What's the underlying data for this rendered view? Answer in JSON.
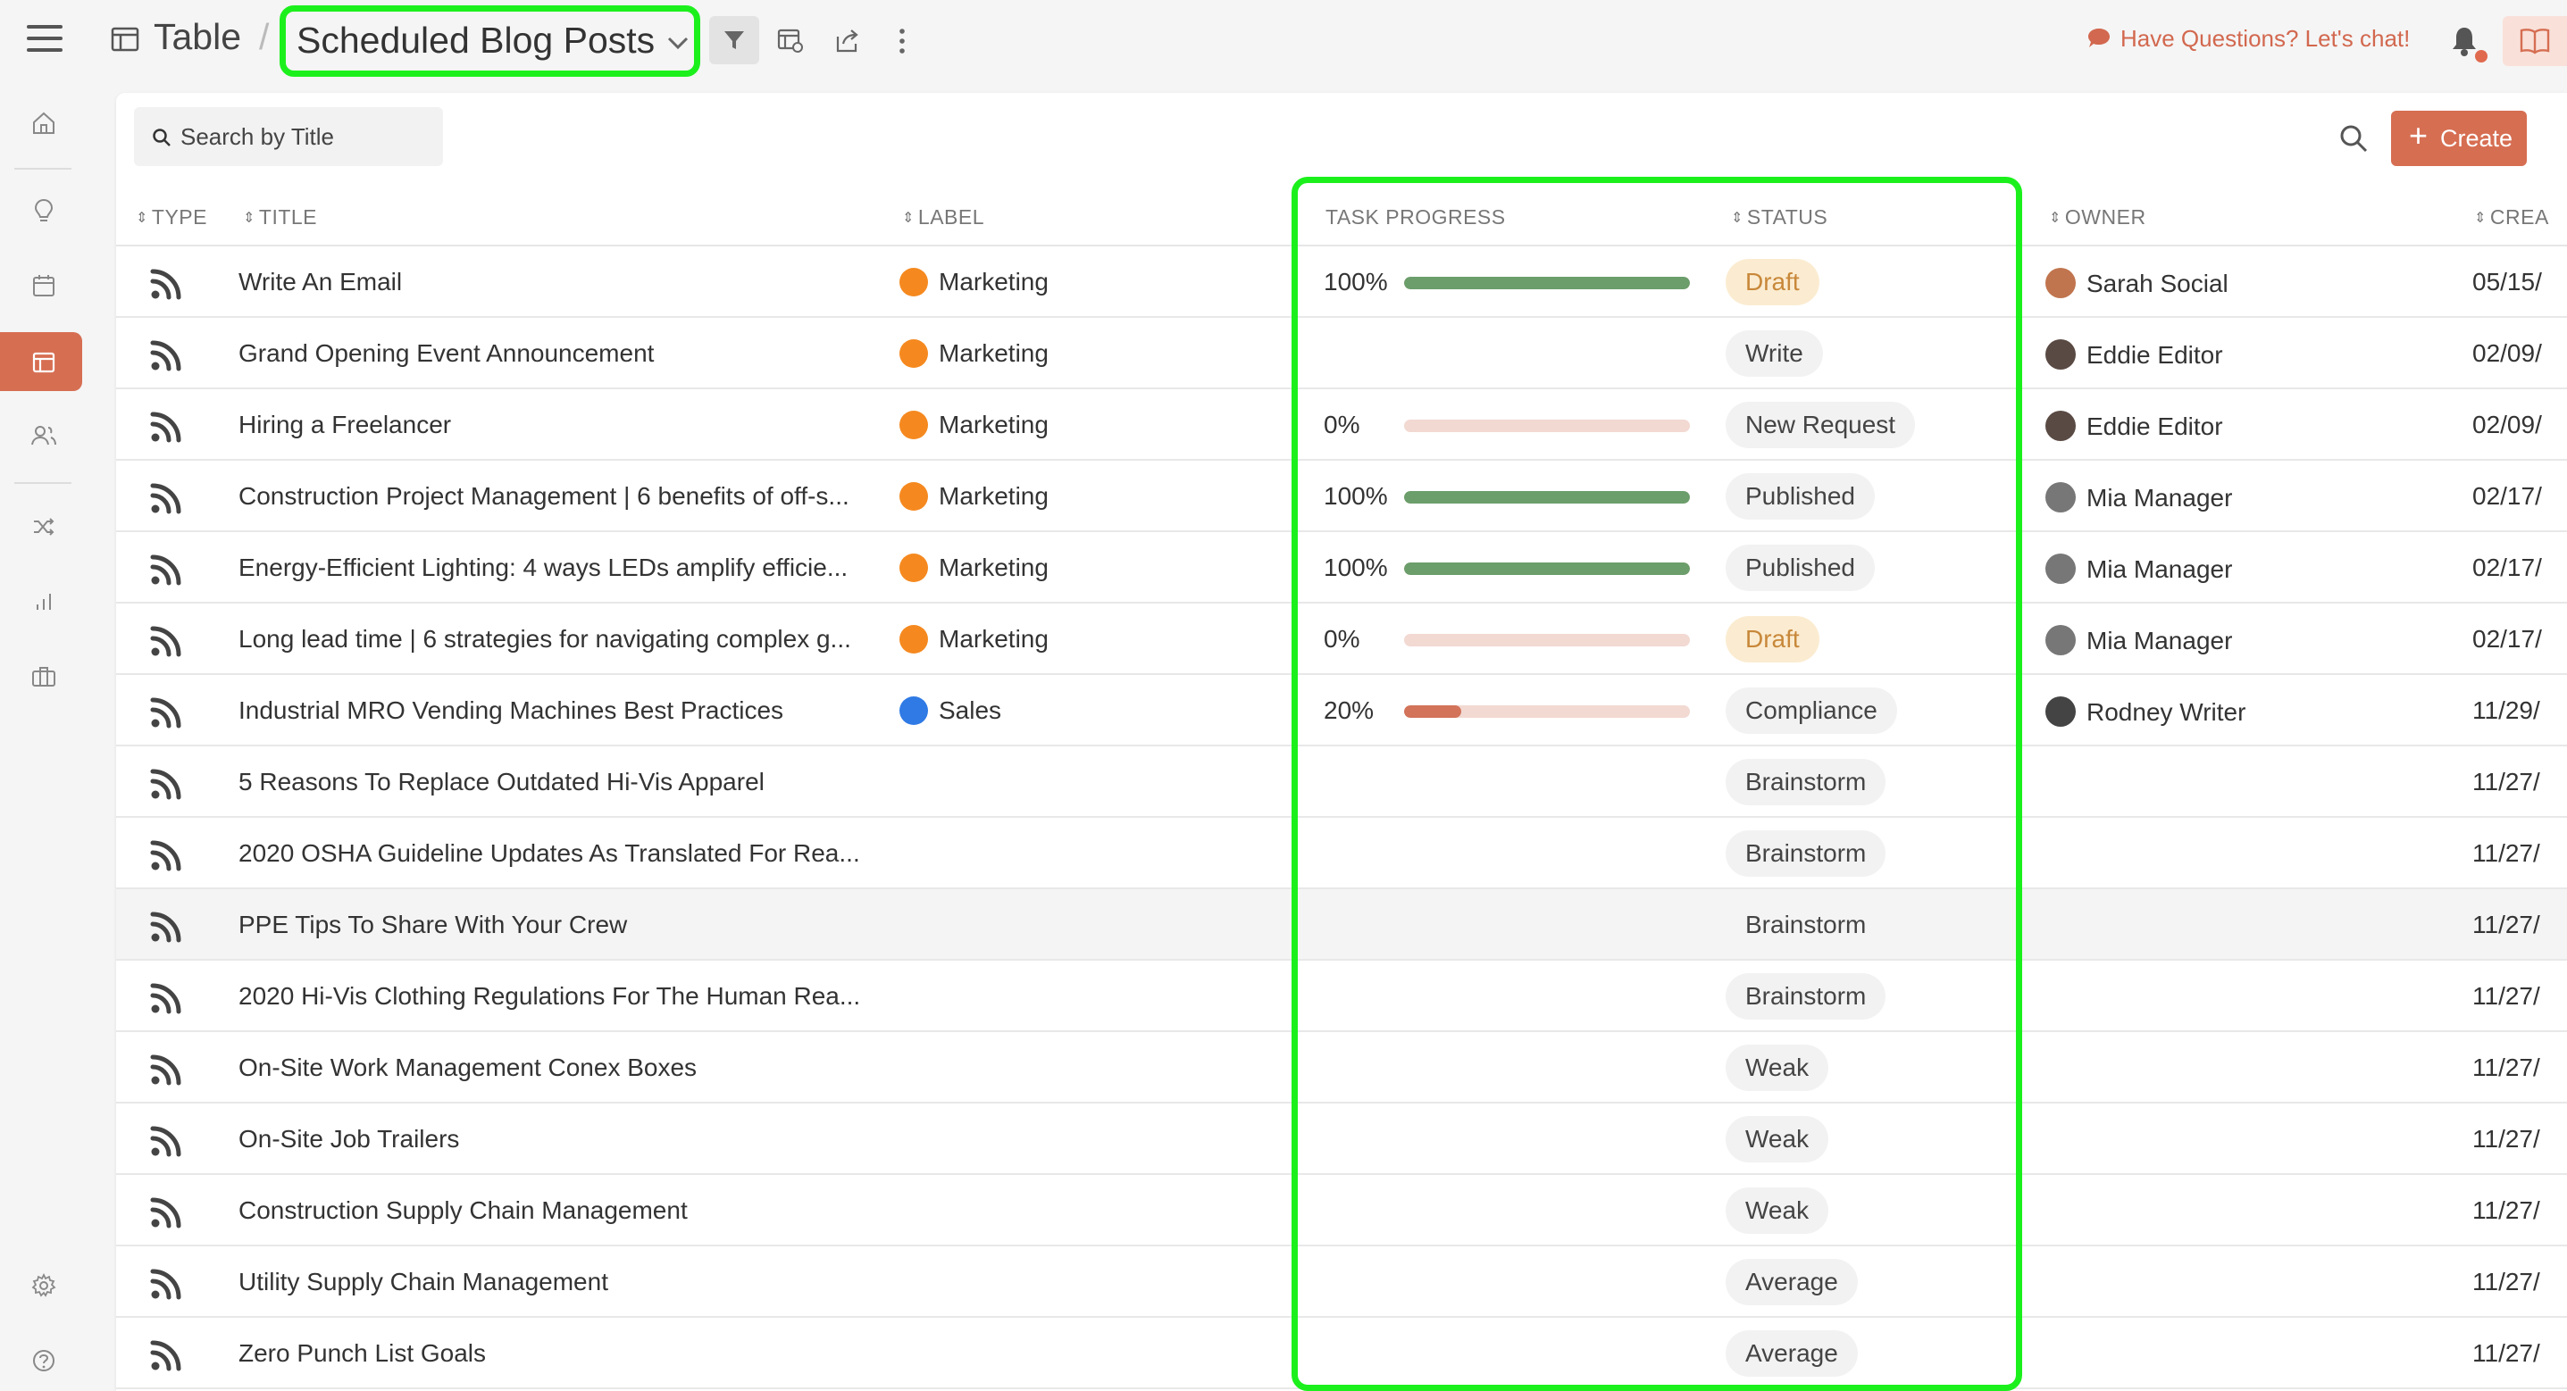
{
  "header": {
    "breadcrumb_root": "Table",
    "breadcrumb_sep": "/",
    "view_title": "Scheduled Blog Posts",
    "chat_link": "Have Questions? Let's chat!",
    "accent_color": "#d66e52"
  },
  "sidebar": {
    "items": [
      {
        "icon": "home-icon"
      },
      {
        "icon": "lightbulb-icon"
      },
      {
        "icon": "calendar-icon"
      },
      {
        "icon": "table-icon",
        "active": true
      },
      {
        "icon": "users-icon"
      },
      {
        "icon": "shuffle-icon"
      },
      {
        "icon": "bar-chart-icon"
      },
      {
        "icon": "briefcase-icon"
      },
      {
        "icon": "settings-icon"
      },
      {
        "icon": "help-icon"
      }
    ]
  },
  "toolbar": {
    "search_placeholder": "Search by Title",
    "create_label": "Create"
  },
  "table": {
    "columns": {
      "type": "TYPE",
      "title": "TITLE",
      "label": "LABEL",
      "task_progress": "TASK PROGRESS",
      "status": "STATUS",
      "owner": "OWNER",
      "created": "CREA"
    },
    "rows": [
      {
        "title": "Write An Email",
        "label": "Marketing",
        "label_color": "#f5891f",
        "progress": "100%",
        "progress_value": 100,
        "status": "Draft",
        "status_style": "draft",
        "owner": "Sarah Social",
        "created": "05/15/"
      },
      {
        "title": "Grand Opening Event Announcement",
        "label": "Marketing",
        "label_color": "#f5891f",
        "progress": "",
        "progress_value": null,
        "status": "Write",
        "status_style": "normal",
        "owner": "Eddie Editor",
        "created": "02/09/"
      },
      {
        "title": "Hiring a Freelancer",
        "label": "Marketing",
        "label_color": "#f5891f",
        "progress": "0%",
        "progress_value": 0,
        "status": "New Request",
        "status_style": "normal",
        "owner": "Eddie Editor",
        "created": "02/09/"
      },
      {
        "title": "Construction Project Management | 6 benefits of off-s...",
        "label": "Marketing",
        "label_color": "#f5891f",
        "progress": "100%",
        "progress_value": 100,
        "status": "Published",
        "status_style": "normal",
        "owner": "Mia Manager",
        "created": "02/17/"
      },
      {
        "title": "Energy-Efficient Lighting: 4 ways LEDs amplify efficie...",
        "label": "Marketing",
        "label_color": "#f5891f",
        "progress": "100%",
        "progress_value": 100,
        "status": "Published",
        "status_style": "normal",
        "owner": "Mia Manager",
        "created": "02/17/"
      },
      {
        "title": "Long lead time | 6 strategies for navigating complex g...",
        "label": "Marketing",
        "label_color": "#f5891f",
        "progress": "0%",
        "progress_value": 0,
        "status": "Draft",
        "status_style": "draft",
        "owner": "Mia Manager",
        "created": "02/17/"
      },
      {
        "title": "Industrial MRO Vending Machines Best Practices",
        "label": "Sales",
        "label_color": "#2f7ae5",
        "progress": "20%",
        "progress_value": 20,
        "status": "Compliance",
        "status_style": "normal",
        "owner": "Rodney Writer",
        "created": "11/29/"
      },
      {
        "title": "5 Reasons To Replace Outdated Hi-Vis Apparel",
        "label": "",
        "label_color": "",
        "progress": "",
        "progress_value": null,
        "status": "Brainstorm",
        "status_style": "normal",
        "owner": "",
        "created": "11/27/"
      },
      {
        "title": "2020 OSHA Guideline Updates As Translated For Rea...",
        "label": "",
        "label_color": "",
        "progress": "",
        "progress_value": null,
        "status": "Brainstorm",
        "status_style": "normal",
        "owner": "",
        "created": "11/27/"
      },
      {
        "title": "PPE Tips To Share With Your Crew",
        "label": "",
        "label_color": "",
        "progress": "",
        "progress_value": null,
        "status": "Brainstorm",
        "status_style": "plain",
        "owner": "",
        "created": "11/27/",
        "hover": true
      },
      {
        "title": "2020 Hi-Vis Clothing Regulations For The Human Rea...",
        "label": "",
        "label_color": "",
        "progress": "",
        "progress_value": null,
        "status": "Brainstorm",
        "status_style": "normal",
        "owner": "",
        "created": "11/27/"
      },
      {
        "title": "On-Site Work Management Conex Boxes",
        "label": "",
        "label_color": "",
        "progress": "",
        "progress_value": null,
        "status": "Weak",
        "status_style": "normal",
        "owner": "",
        "created": "11/27/"
      },
      {
        "title": "On-Site Job Trailers",
        "label": "",
        "label_color": "",
        "progress": "",
        "progress_value": null,
        "status": "Weak",
        "status_style": "normal",
        "owner": "",
        "created": "11/27/"
      },
      {
        "title": "Construction Supply Chain Management",
        "label": "",
        "label_color": "",
        "progress": "",
        "progress_value": null,
        "status": "Weak",
        "status_style": "normal",
        "owner": "",
        "created": "11/27/"
      },
      {
        "title": "Utility Supply Chain Management",
        "label": "",
        "label_color": "",
        "progress": "",
        "progress_value": null,
        "status": "Average",
        "status_style": "normal",
        "owner": "",
        "created": "11/27/"
      },
      {
        "title": "Zero Punch List Goals",
        "label": "",
        "label_color": "",
        "progress": "",
        "progress_value": null,
        "status": "Average",
        "status_style": "normal",
        "owner": "",
        "created": "11/27/"
      }
    ]
  },
  "colors": {
    "progress_complete": "#6b9e6b",
    "progress_partial": "#d2735a",
    "progress_track": "#f2d9d2",
    "highlight": "#1cf01c"
  }
}
